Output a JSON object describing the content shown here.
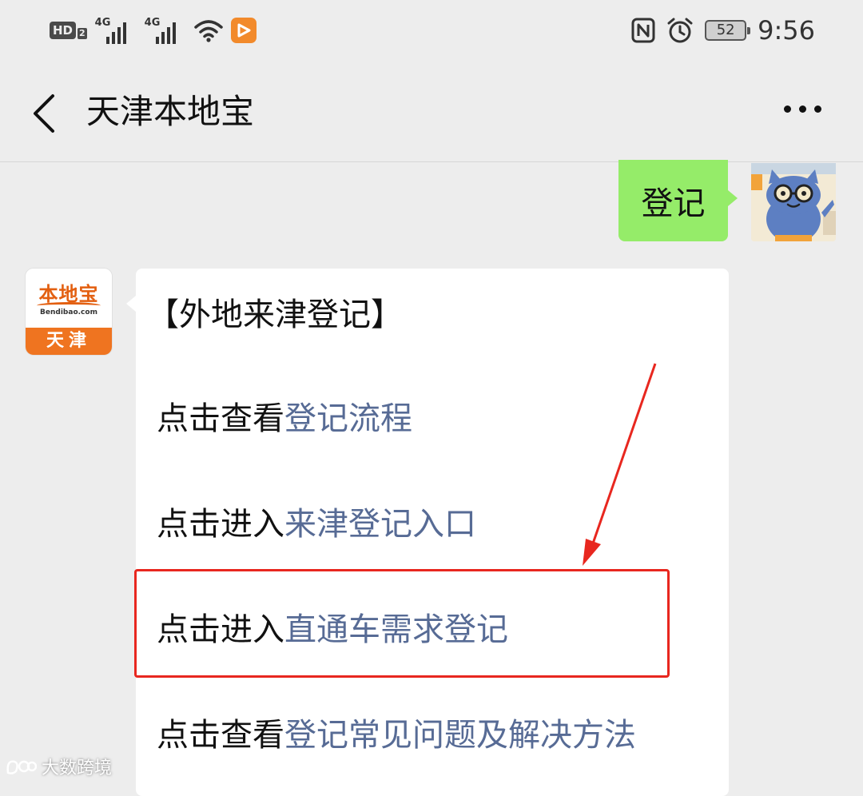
{
  "status_bar": {
    "hd_label": "HD",
    "hd_sub": "2",
    "network_1": "4G",
    "network_2": "4G",
    "battery_level": "52",
    "time": "9:56",
    "icons": [
      "signal-icon",
      "wifi-icon",
      "video-app-icon",
      "nfc-icon",
      "alarm-icon",
      "battery-icon"
    ]
  },
  "header": {
    "title": "天津本地宝",
    "back_icon": "chevron-left-icon",
    "more_icon": "more-dots-icon"
  },
  "chat": {
    "my_message": "登记",
    "bot_avatar": {
      "brand": "本地宝",
      "url": "Bendibao.com",
      "city": "天津"
    },
    "bot_message": {
      "heading": "【外地来津登记】",
      "lines": [
        {
          "prefix": "点击查看",
          "link": "登记流程"
        },
        {
          "prefix": "点击进入",
          "link": "来津登记入口"
        },
        {
          "prefix": "点击进入",
          "link": "直通车需求登记"
        },
        {
          "prefix": "点击查看",
          "link": "登记常见问题及解决方法"
        }
      ]
    }
  },
  "colors": {
    "background": "#ededed",
    "my_bubble": "#95ec69",
    "link": "#576b95",
    "highlight_box": "#e8271f",
    "brand_orange": "#ef7420"
  },
  "watermark": {
    "text": "大数跨境"
  }
}
